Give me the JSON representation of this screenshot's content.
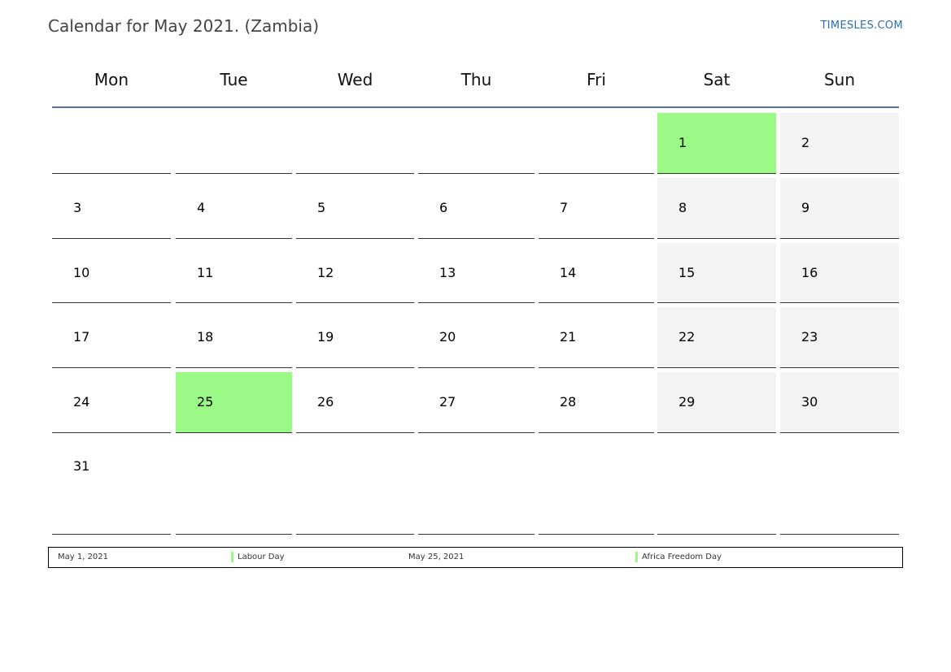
{
  "header": {
    "title": "Calendar for May 2021. (Zambia)",
    "site": "TIMESLES.COM"
  },
  "colors": {
    "holiday": "#9afa85",
    "weekend": "#f3f3f3",
    "header_rule": "#5a7398",
    "link": "#2a6fb5"
  },
  "calendar": {
    "weekdays": [
      "Mon",
      "Tue",
      "Wed",
      "Thu",
      "Fri",
      "Sat",
      "Sun"
    ],
    "weeks": [
      [
        null,
        null,
        null,
        null,
        null,
        "1",
        "2"
      ],
      [
        "3",
        "4",
        "5",
        "6",
        "7",
        "8",
        "9"
      ],
      [
        "10",
        "11",
        "12",
        "13",
        "14",
        "15",
        "16"
      ],
      [
        "17",
        "18",
        "19",
        "20",
        "21",
        "22",
        "23"
      ],
      [
        "24",
        "25",
        "26",
        "27",
        "28",
        "29",
        "30"
      ],
      [
        "31",
        null,
        null,
        null,
        null,
        null,
        null
      ]
    ],
    "holiday_days": [
      "1",
      "25"
    ]
  },
  "legend": [
    {
      "date": "May 1, 2021",
      "name": "Labour Day"
    },
    {
      "date": "May 25, 2021",
      "name": "Africa Freedom Day"
    }
  ]
}
